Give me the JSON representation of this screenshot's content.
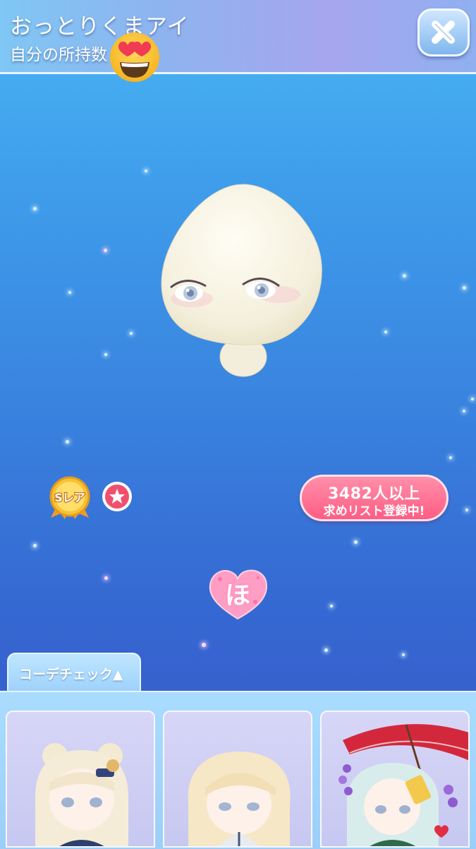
{
  "header": {
    "item_name": "おっとりくまアイ",
    "owned_label": "自分の所持数",
    "close_icon": "close-x-icon"
  },
  "overlay": {
    "emoji": "heart-eyes-emoji"
  },
  "item": {
    "image": "face-eyes-item-preview"
  },
  "rarity": {
    "badge_icon": "s-rare-medal-icon",
    "badge_text": "Sレア"
  },
  "favorite": {
    "icon": "star-icon"
  },
  "wishlist": {
    "count": "3482人以上",
    "text": "求めリスト登録中!"
  },
  "heart_button": {
    "char": "ほ"
  },
  "coordinate_check": {
    "tab_label": "コーデチェック▲"
  },
  "cards": [
    {
      "name": "coordinate-card-1"
    },
    {
      "name": "coordinate-card-2"
    },
    {
      "name": "coordinate-card-3"
    }
  ],
  "colors": {
    "accent_pink": "#ff5d84",
    "top_bar": "#8fb3ef",
    "background_top": "#4bb6f3",
    "background_bottom": "#3a54c6"
  }
}
